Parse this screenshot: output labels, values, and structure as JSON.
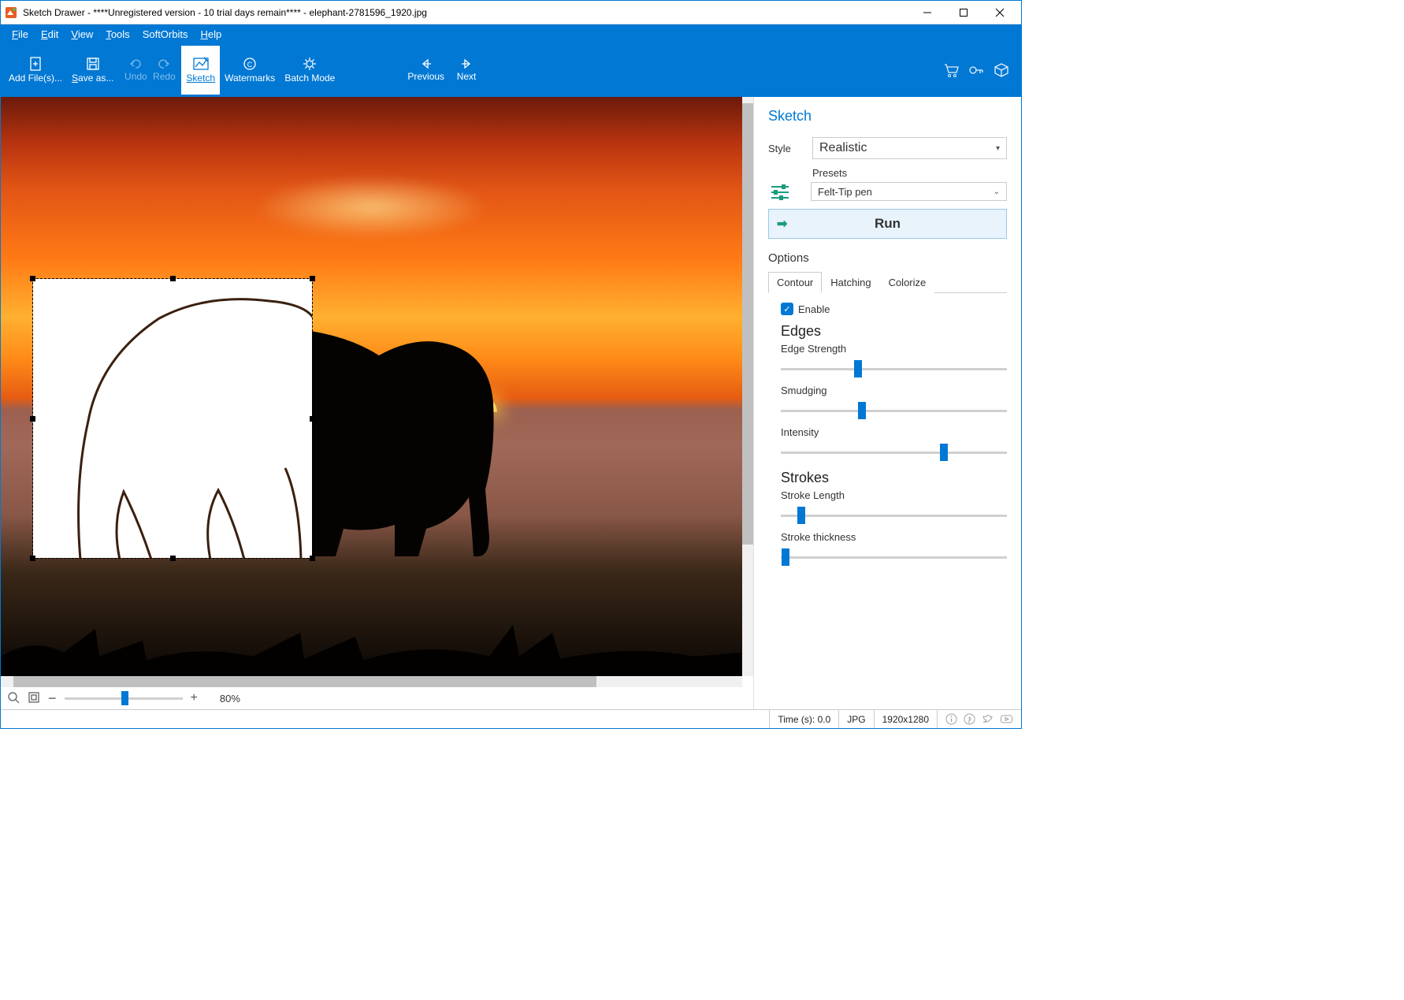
{
  "title": "Sketch Drawer - ****Unregistered version - 10 trial days remain**** - elephant-2781596_1920.jpg",
  "menu": {
    "file": "File",
    "edit": "Edit",
    "view": "View",
    "tools": "Tools",
    "softorbits": "SoftOrbits",
    "help": "Help"
  },
  "toolbar": {
    "add": "Add File(s)...",
    "save": "Save as...",
    "undo": "Undo",
    "redo": "Redo",
    "sketch": "Sketch",
    "watermarks": "Watermarks",
    "batch": "Batch Mode",
    "previous": "Previous",
    "next": "Next"
  },
  "zoom": {
    "percent": "80%"
  },
  "panel": {
    "title": "Sketch",
    "style_label": "Style",
    "style_value": "Realistic",
    "presets_label": "Presets",
    "preset_value": "Felt-Tip pen",
    "run": "Run",
    "options": "Options",
    "tabs": {
      "contour": "Contour",
      "hatching": "Hatching",
      "colorize": "Colorize"
    },
    "enable": "Enable",
    "edges_head": "Edges",
    "edge_strength": "Edge Strength",
    "smudging": "Smudging",
    "intensity": "Intensity",
    "strokes_head": "Strokes",
    "stroke_length": "Stroke Length",
    "stroke_thickness": "Stroke thickness",
    "sliders": {
      "edge_strength": 34,
      "smudging": 36,
      "intensity": 72,
      "stroke_length": 9,
      "stroke_thickness": 2
    }
  },
  "status": {
    "time": "Time (s): 0.0",
    "format": "JPG",
    "dimensions": "1920x1280"
  }
}
